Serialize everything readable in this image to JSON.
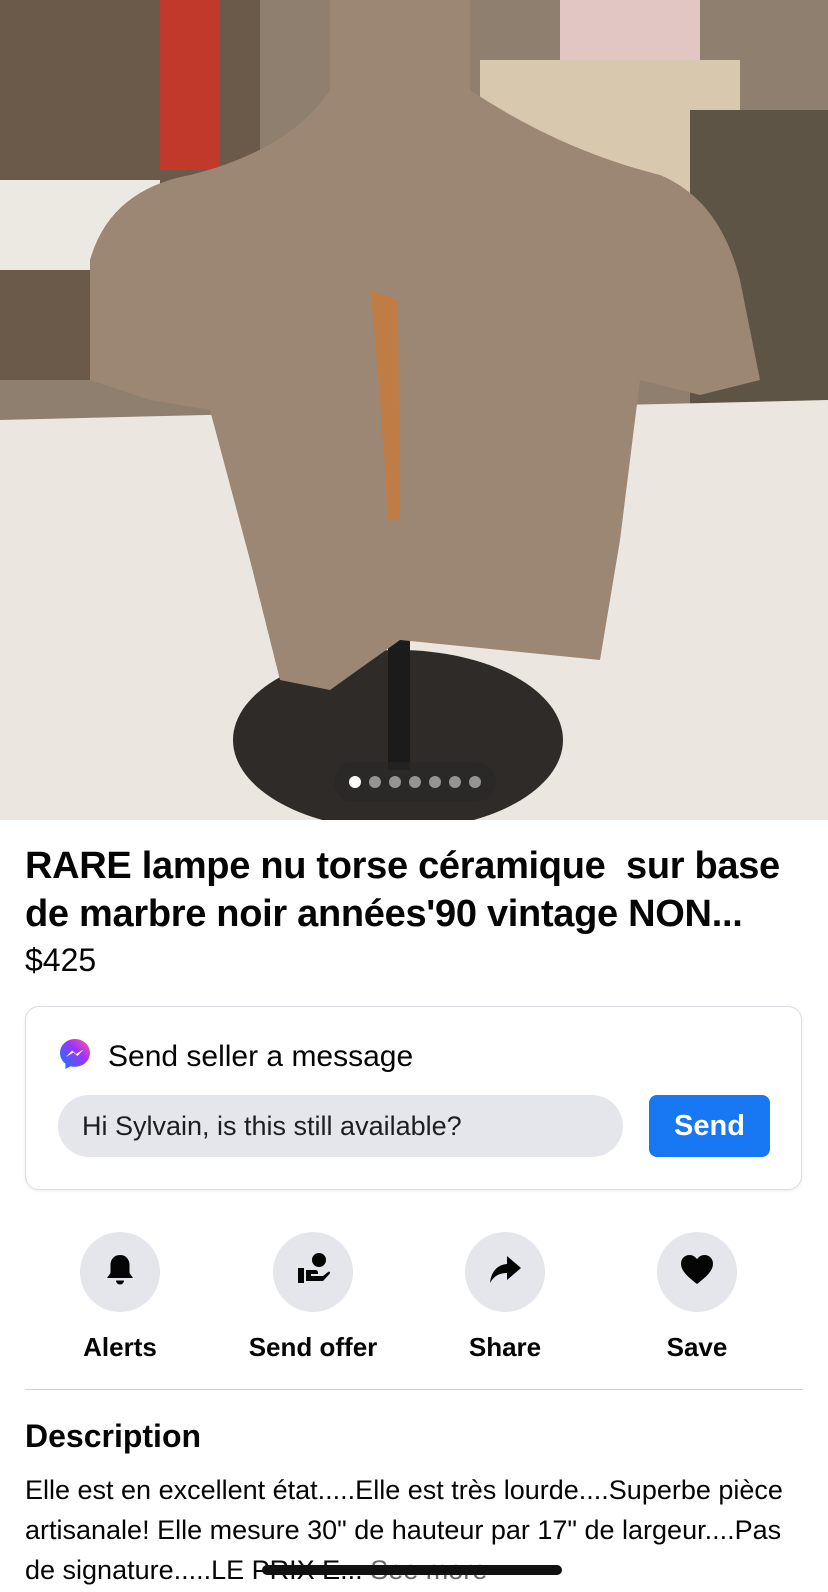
{
  "listing": {
    "title": "RARE lampe nu torse céramique  sur base de marbre noir années'90 vintage NON...",
    "price": "$425",
    "photo_count": 7,
    "active_photo_index": 0
  },
  "message_card": {
    "header": "Send seller a message",
    "input_value": "Hi Sylvain, is this still available?",
    "send_label": "Send",
    "messenger_icon": "messenger-icon"
  },
  "actions": [
    {
      "label": "Alerts",
      "icon": "bell-icon"
    },
    {
      "label": "Send offer",
      "icon": "offer-icon"
    },
    {
      "label": "Share",
      "icon": "share-icon"
    },
    {
      "label": "Save",
      "icon": "heart-icon"
    }
  ],
  "description": {
    "heading": "Description",
    "text": "Elle est en excellent état.....Elle est très lourde....Superbe pièce artisanale! Elle mesure 30\" de hauteur par 17\" de largeur....Pas de signature.....LE PRIX E...",
    "see_more": "See more"
  },
  "colors": {
    "accent": "#1877f2",
    "chip_bg": "#e4e6eb",
    "muted_text": "#65676b"
  }
}
